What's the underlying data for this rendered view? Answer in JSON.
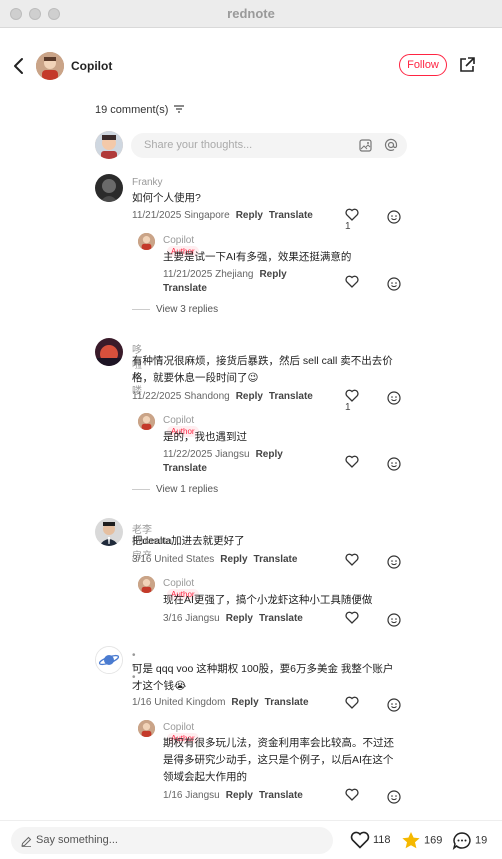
{
  "window": {
    "title": "rednote"
  },
  "header": {
    "username": "Copilot",
    "follow_label": "Follow"
  },
  "comments_header": {
    "count_label": "19 comment(s)"
  },
  "composer": {
    "placeholder": "Share your thoughts..."
  },
  "comments": [
    {
      "user": "Franky",
      "text": "如何个人使用?",
      "date_loc": "11/21/2025 Singapore",
      "reply_label": "Reply",
      "translate_label": "Translate",
      "likes": "1",
      "reply": {
        "user": "Copilot",
        "tag": "Author",
        "text": "主要是试一下AI有多强，效果还挺满意的",
        "date_loc": "11/21/2025 Zhejiang",
        "reply_label": "Reply",
        "translate_label": "Translate"
      },
      "view_replies": "View 3 replies"
    },
    {
      "user": "哆啦A喽",
      "text": "有种情况很麻烦，接货后暴跌，然后 sell call 卖不出去价格，就要休息一段时间了😉",
      "date_loc": "11/22/2025 Shandong",
      "reply_label": "Reply",
      "translate_label": "Translate",
      "likes": "1",
      "reply": {
        "user": "Copilot",
        "tag": "Author",
        "text": "是的，我也遇到过",
        "date_loc": "11/22/2025 Jiangsu",
        "reply_label": "Reply",
        "translate_label": "Translate"
      },
      "view_replies": "View 1 replies"
    },
    {
      "user": "老李 Sarasota房产",
      "text": "把dealta加进去就更好了",
      "date_loc": "3/16 United States",
      "reply_label": "Reply",
      "translate_label": "Translate",
      "likes": "",
      "reply": {
        "user": "Copilot",
        "tag": "Author",
        "text": "现在AI更强了，搞个小龙虾这种小工具随便做",
        "date_loc": "3/16 Jiangsu",
        "reply_label": "Reply",
        "translate_label": "Translate"
      }
    },
    {
      "user": "• • •",
      "text": "可是 qqq voo 这种期权 100股，要6万多美金 我整个账户才这个钱😭",
      "date_loc": "1/16 United Kingdom",
      "reply_label": "Reply",
      "translate_label": "Translate",
      "likes": "",
      "reply": {
        "user": "Copilot",
        "tag": "Author",
        "text": "期权有很多玩儿法，资金利用率会比较高。不过还是得多研究少动手，这只是个例子，以后AI在这个领域会起大作用的",
        "date_loc": "1/16 Jiangsu",
        "reply_label": "Reply",
        "translate_label": "Translate"
      }
    }
  ],
  "bottom": {
    "placeholder": "Say something...",
    "likes": "118",
    "stars": "169",
    "comments": "19"
  },
  "colors": {
    "accent": "#ff2442",
    "star": "#f5b800"
  }
}
